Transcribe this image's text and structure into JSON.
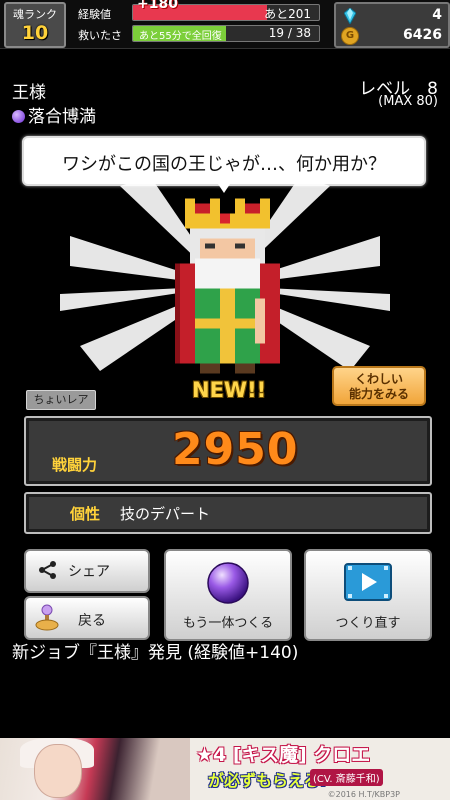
{
  "status": {
    "rank_label": "魂ランク",
    "rank_value": "10",
    "exp_label": "経験値",
    "exp_gain": "+180",
    "exp_remaining": "あと201",
    "exp_progress": 0.72,
    "rescue_label": "救いたさ",
    "rescue_timer": "あと55分で全回復",
    "rescue_count": "19 / 38",
    "rescue_progress": 0.5,
    "gems": "4",
    "coins": "6426",
    "exp_color": "#e8384f",
    "rescue_color": "#7ccf3a"
  },
  "character": {
    "name": "王様",
    "owner": "落合博満",
    "level_label": "レベル　8",
    "level_max": "(MAX 80)",
    "speech": "ワシがこの国の王じゃが…、何か用か？",
    "new_badge": "NEW!!",
    "rarity": "ちょいレア",
    "detail_button": "くわしい\n能力をみる",
    "power_label": "戦闘力",
    "power_value": "2950",
    "trait_label": "個性",
    "trait_value": "技のデパート"
  },
  "actions": {
    "share": "シェア",
    "back": "戻る",
    "make_another": "もう一体つくる",
    "remake": "つくり直す"
  },
  "message": "新ジョブ『王様』発見 (経験値+140)",
  "ad": {
    "headline": "★4 [キス魔] クロエ",
    "subline": "が必ずもらえる!",
    "cv": "(CV. 斎藤千和)",
    "copyright": "©2016 H.T/KBP3P"
  }
}
